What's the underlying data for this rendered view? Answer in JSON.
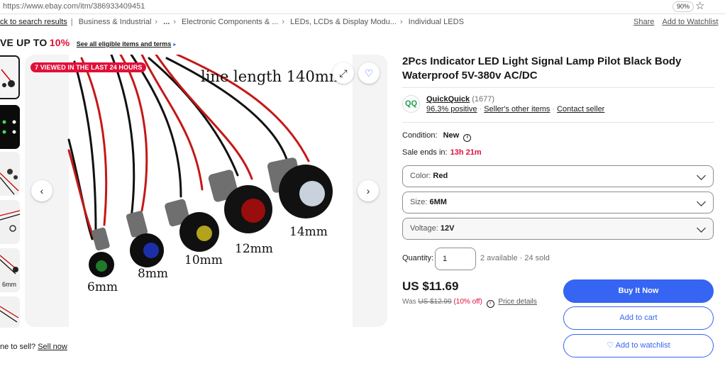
{
  "browser": {
    "url": "https://www.ebay.com/itm/386933409451",
    "zoom": "90%",
    "bookmark_icon": "star-icon"
  },
  "breadcrumb": {
    "back": "ck to search results",
    "items": [
      "Business & Industrial",
      "...",
      "Electronic Components & ...",
      "LEDs, LCDs & Display Modu...",
      "Individual LEDS"
    ]
  },
  "top_links": {
    "share": "Share",
    "watchlist": "Add to Watchlist"
  },
  "promo": {
    "prefix": "VE UP TO",
    "percent": "10%",
    "terms": "See all eligible items and terms",
    "arrow": "▸"
  },
  "gallery": {
    "badge": "7 VIEWED IN THE LAST 24 HOURS",
    "expand_icon": "expand-icon",
    "heart_icon": "heart-icon",
    "prev_icon": "chevron-left-icon",
    "next_icon": "chevron-right-icon",
    "photo": {
      "caption": "line length 140mm",
      "sizes": [
        "6mm",
        "8mm",
        "10mm",
        "12mm",
        "14mm"
      ],
      "lens_colors": [
        "#1f7a2a",
        "#1c2fa8",
        "#b3a21c",
        "#9a0d0d",
        "#c9d2dc"
      ]
    },
    "thumb_labels": [
      "6mm"
    ]
  },
  "product": {
    "title": "2Pcs Indicator LED Light Signal Lamp Pilot Black Body Waterproof 5V-380v AC/DC"
  },
  "seller": {
    "logo_text": "QQ",
    "name": "QuickQuick",
    "count": "(1677)",
    "positive": "96.3% positive",
    "other_items": "Seller's other items",
    "contact": "Contact seller"
  },
  "condition": {
    "label": "Condition:",
    "value": "New",
    "info_icon": "info-icon"
  },
  "sale": {
    "label": "Sale ends in:",
    "time": "13h 21m"
  },
  "selects": [
    {
      "label": "Color:",
      "value": "Red"
    },
    {
      "label": "Size:",
      "value": "6MM"
    },
    {
      "label": "Voltage:",
      "value": "12V"
    }
  ],
  "quantity": {
    "label": "Quantity:",
    "value": "1",
    "available": "2 available",
    "sold": "24 sold"
  },
  "pricing": {
    "price": "US $11.69",
    "was_label": "Was",
    "was_price": "US $12.99",
    "off": "(10% off)",
    "details": "Price details"
  },
  "buttons": {
    "buy": "Buy It Now",
    "cart": "Add to cart",
    "watch": "Add to watchlist",
    "watch_icon": "heart-icon"
  },
  "sell": {
    "prefix": "ne to sell?",
    "link": "Sell now"
  },
  "colors": {
    "accent": "#3665f3",
    "alert": "#e0103a"
  }
}
